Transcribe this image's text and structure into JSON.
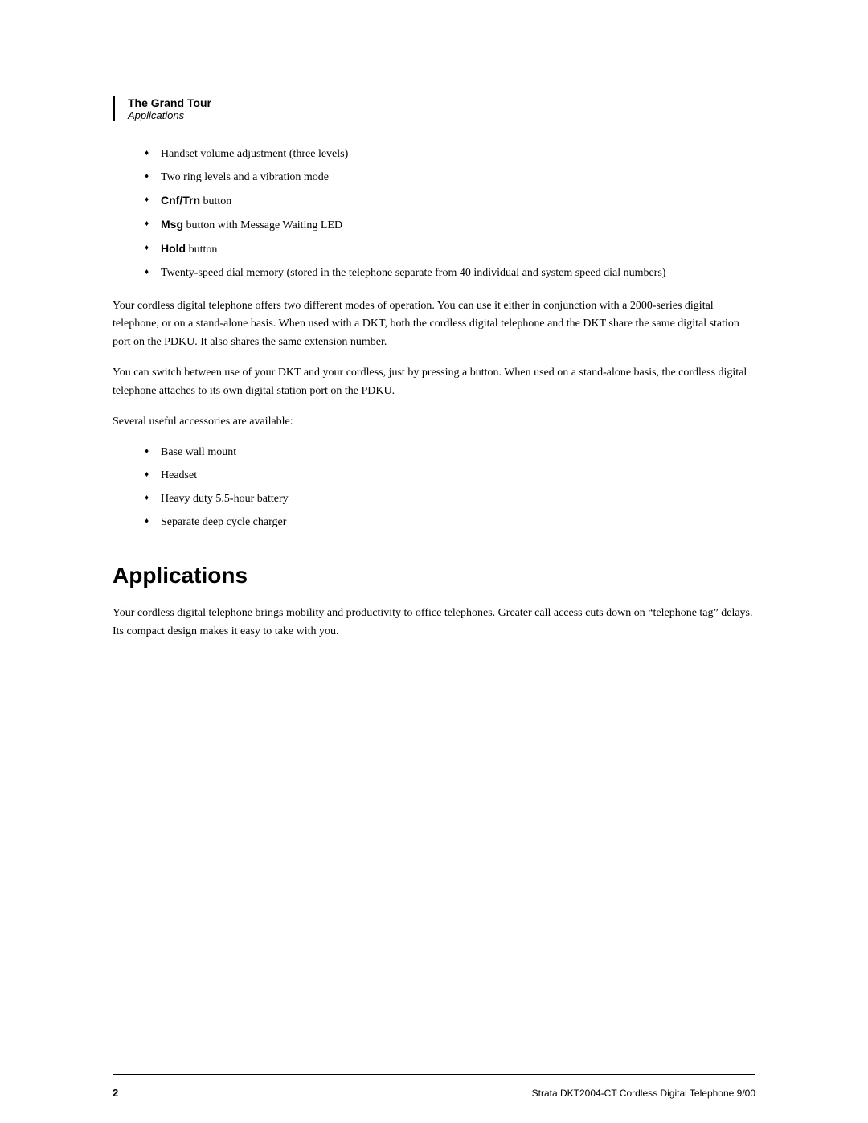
{
  "header": {
    "title": "The Grand Tour",
    "subtitle": "Applications"
  },
  "bullets_top": [
    {
      "text": "Handset volume adjustment (three levels)",
      "bold_prefix": null,
      "bold_text": null
    },
    {
      "text": "Two ring levels and a vibration mode",
      "bold_prefix": null,
      "bold_text": null
    },
    {
      "text": " button",
      "bold_prefix": null,
      "bold_text": "Cnf/Trn"
    },
    {
      "text": " button with Message Waiting LED",
      "bold_prefix": null,
      "bold_text": "Msg"
    },
    {
      "text": " button",
      "bold_prefix": null,
      "bold_text": "Hold"
    },
    {
      "text": "Twenty-speed dial memory (stored in the telephone separate from 40 individual and system speed dial numbers)",
      "bold_prefix": null,
      "bold_text": null
    }
  ],
  "paragraph1": "Your cordless digital telephone offers two different modes of operation. You can use it either in conjunction with a 2000-series digital telephone, or on a stand-alone basis. When used with a DKT, both the cordless digital telephone and the DKT share the same digital station port on the PDKU. It also shares the same extension number.",
  "paragraph2": "You can switch between use of your DKT and your cordless, just by pressing a button. When used on a stand-alone basis, the cordless digital telephone attaches to its own digital station port on the PDKU.",
  "paragraph3": "Several useful accessories are available:",
  "bullets_accessories": [
    "Base wall mount",
    "Headset",
    "Heavy duty 5.5-hour battery",
    "Separate deep cycle charger"
  ],
  "section_title": "Applications",
  "paragraph4": "Your cordless digital telephone brings mobility and productivity to office telephones. Greater call access cuts down on “telephone tag” delays. Its compact design makes it easy to take with you.",
  "footer": {
    "page_number": "2",
    "doc_title": "Strata DKT2004-CT Cordless Digital Telephone  9/00"
  }
}
